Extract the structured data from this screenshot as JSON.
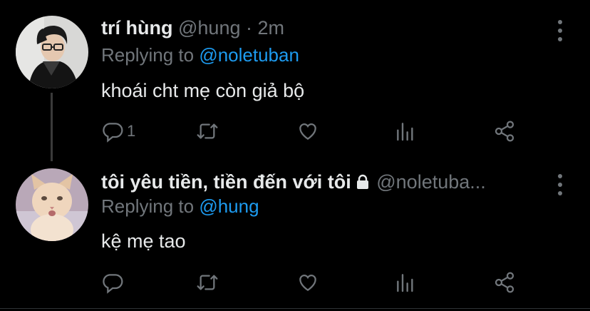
{
  "tweets": [
    {
      "name": "trí hùng",
      "handle": "@hung",
      "separator": "·",
      "time": "2m",
      "replying_label": "Replying to",
      "replying_to": "@noletuban",
      "text": "khoái cht mẹ còn giả bộ",
      "reply_count": "1",
      "avatar": "user-photo-avatar"
    },
    {
      "name": "tôi yêu tiền, tiền đến với tôi",
      "handle": "@noletuba...",
      "replying_label": "Replying to",
      "replying_to": "@hung",
      "text": "kệ mẹ tao",
      "reply_count": "",
      "avatar": "kitten-avatar"
    }
  ],
  "icons": [
    "reply-icon",
    "retweet-icon",
    "like-icon",
    "analytics-icon",
    "share-icon",
    "more-icon",
    "lock-icon"
  ],
  "colors": {
    "background": "#000000",
    "text": "#e7e9ea",
    "muted": "#71767b",
    "accent": "#1d9bf0"
  }
}
